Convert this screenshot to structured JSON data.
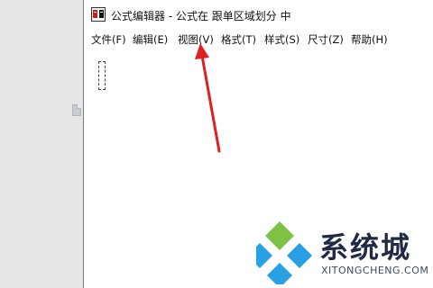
{
  "window": {
    "title": "公式编辑器 - 公式在 跟单区域划分 中"
  },
  "menu": {
    "items": [
      {
        "label": "文件(F)"
      },
      {
        "label": "编辑(E)"
      },
      {
        "label": "视图(V)"
      },
      {
        "label": "格式(T)"
      },
      {
        "label": "样式(S)"
      },
      {
        "label": "尺寸(Z)"
      },
      {
        "label": "帮助(H)"
      }
    ]
  },
  "annotation": {
    "arrow_color": "#e02020"
  },
  "watermark": {
    "brand": "系统城",
    "url": "XITONGCHENG.COM"
  }
}
